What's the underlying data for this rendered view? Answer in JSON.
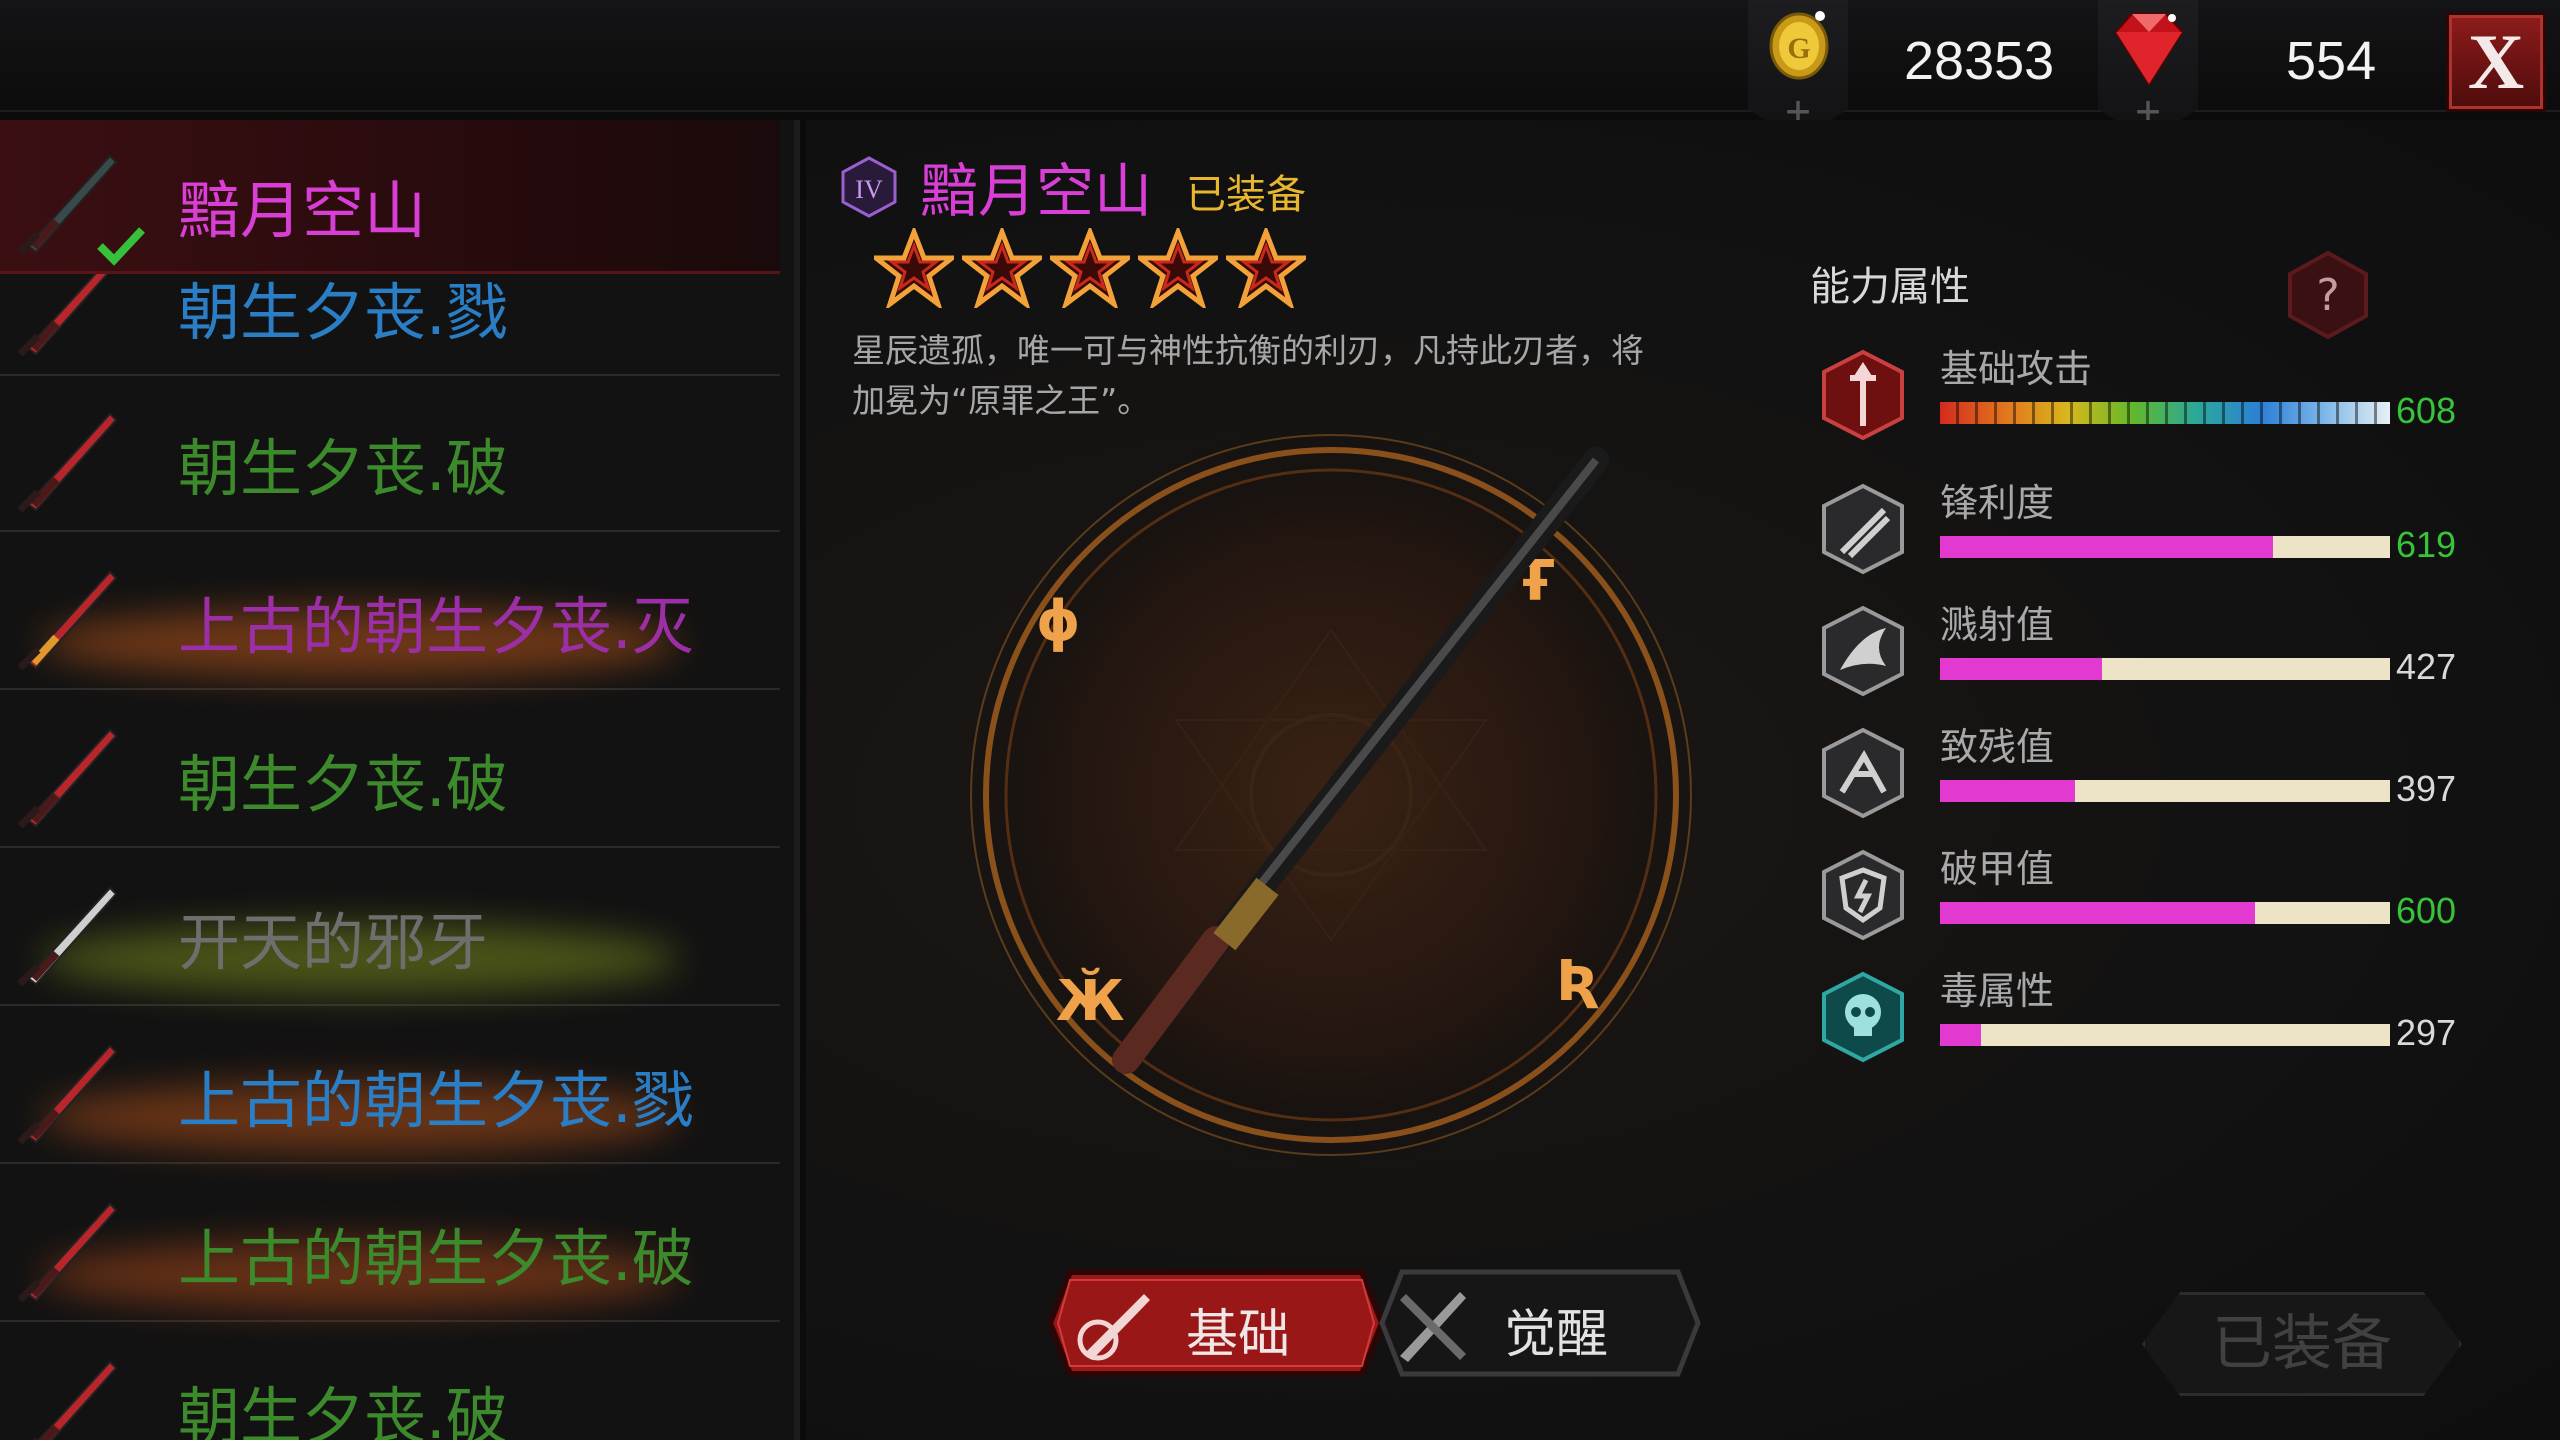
{
  "currency": {
    "gold": "28353",
    "gems": "554",
    "add_symbol": "+",
    "close_label": "X"
  },
  "weapon_list": [
    {
      "name": "黯月空山",
      "color": "#d93fd6",
      "selected": true,
      "equipped": true
    },
    {
      "name": "朝生夕丧.戮",
      "color": "#2a7ec6"
    },
    {
      "name": "朝生夕丧.破",
      "color": "#3d8a2c"
    },
    {
      "name": "上古的朝生夕丧.灭",
      "color": "#9c2fa8"
    },
    {
      "name": "朝生夕丧.破",
      "color": "#3d8a2c"
    },
    {
      "name": "开天的邪牙",
      "color": "#6e6e6e"
    },
    {
      "name": "上古的朝生夕丧.戮",
      "color": "#2a7ec6"
    },
    {
      "name": "上古的朝生夕丧.破",
      "color": "#3d8a2c"
    },
    {
      "name": "朝生夕丧.破",
      "color": "#3d8a2c"
    }
  ],
  "detail": {
    "tier": "IV",
    "name": "黯月空山",
    "status": "已装备",
    "stars": 5,
    "description": "星辰遗孤，唯一可与神性抗衡的利刃，凡持此刃者，将加冕为“原罪之王”。"
  },
  "tabs": {
    "basic": "基础",
    "awaken": "觉醒"
  },
  "equip_button": "已装备",
  "stats": {
    "title": "能力属性",
    "help": "?",
    "items": [
      {
        "label": "基础攻击",
        "value": "608",
        "fill": 1.0,
        "value_color": "#37c43a",
        "icon": "sword-shield-icon",
        "rainbow": true
      },
      {
        "label": "锋利度",
        "value": "619",
        "fill": 0.74,
        "value_color": "#37c43a",
        "icon": "slash-icon"
      },
      {
        "label": "溅射值",
        "value": "427",
        "fill": 0.36,
        "value_color": "#d9d9d9",
        "icon": "splash-icon"
      },
      {
        "label": "致残值",
        "value": "397",
        "fill": 0.3,
        "value_color": "#d9d9d9",
        "icon": "cripple-icon"
      },
      {
        "label": "破甲值",
        "value": "600",
        "fill": 0.7,
        "value_color": "#37c43a",
        "icon": "armor-break-icon"
      },
      {
        "label": "毒属性",
        "value": "297",
        "fill": 0.09,
        "value_color": "#d9d9d9",
        "icon": "skull-icon"
      }
    ]
  }
}
